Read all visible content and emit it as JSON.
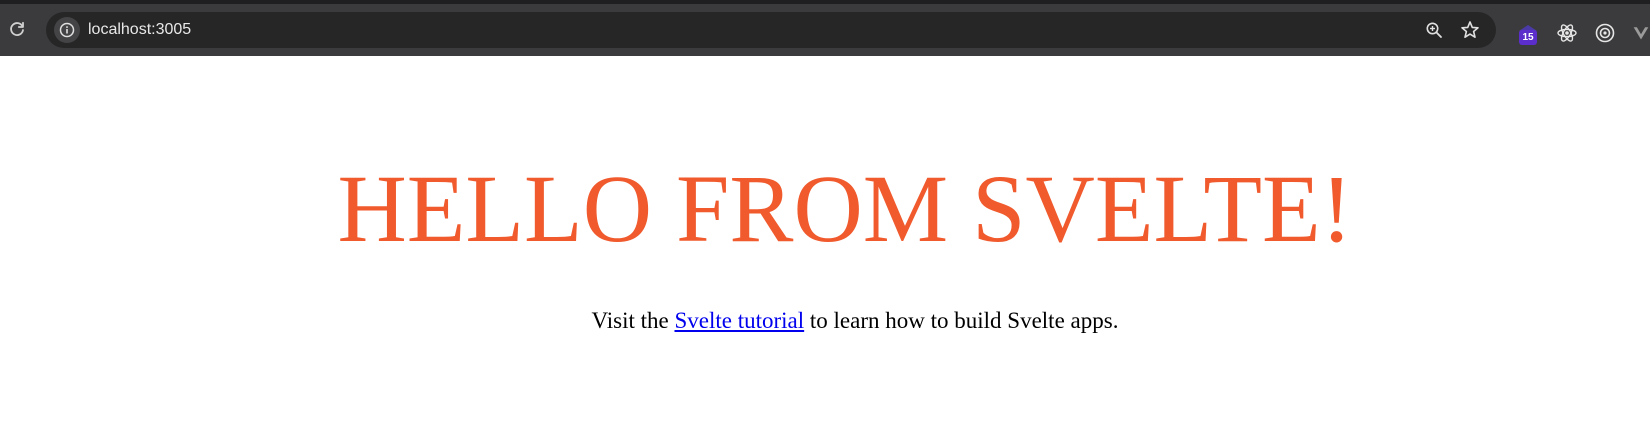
{
  "browser": {
    "url": "localhost:3005",
    "extension_badge": "15",
    "icons": {
      "reload": "reload-icon",
      "site_info": "info-icon",
      "zoom": "zoom-in-icon",
      "bookmark": "star-icon",
      "extension_1": "extension-icon",
      "extension_2": "react-devtools-icon",
      "extension_3": "target-icon",
      "extension_4": "vue-devtools-icon"
    }
  },
  "page": {
    "heading": "HELLO FROM SVELTE!",
    "intro_before": "Visit the ",
    "intro_link": "Svelte tutorial",
    "intro_after": " to learn how to build Svelte apps."
  },
  "colors": {
    "heading": "#f05a2d",
    "link": "#0000ee",
    "toolbar": "#3b3b3d",
    "omnibox": "#262627",
    "badge": "#5b2ecc"
  }
}
